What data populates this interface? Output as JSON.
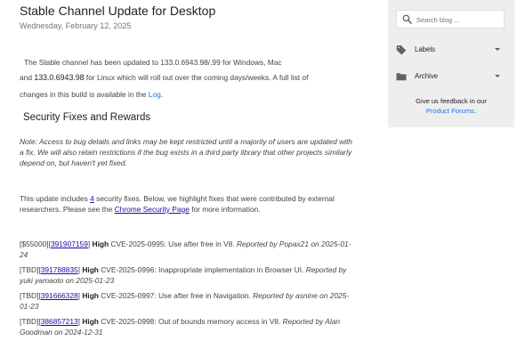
{
  "post": {
    "title": "Stable Channel Update for Desktop",
    "date": "Wednesday, February 12, 2025",
    "intro_line1": "The Stable channel has been updated to 133.0.6943.98/.99 for Windows, Mac",
    "intro_line2_prefix": "and ",
    "intro_line2_version": "133.0.6943.98",
    "intro_line2_suffix": " for Linux which will roll out over the coming days/weeks. A full list of",
    "intro_line3_prefix": "changes in this build is available in the ",
    "log_link": "Log",
    "intro_line3_suffix": ".",
    "section_heading": "Security Fixes and Rewards",
    "note": "Note: Access to bug details and links may be kept restricted until a majority of users are updated with a fix. We will also retain restrictions if the bug exists in a third party library that other projects similarly depend on, but haven't yet fixed.",
    "update_prefix": "This update includes ",
    "update_count": "4",
    "update_middle": " security fixes. Below, we highlight fixes that were contributed by external researchers. Please see the ",
    "security_page_link": "Chrome Security Page",
    "update_suffix": " for more information."
  },
  "fixes": [
    {
      "reward": "[$55000][",
      "bug": "391907159",
      "close": "]",
      "severity": "High",
      "desc": " CVE-2025-0995: Use after free in V8. ",
      "reported": "Reported by Popax21 on 2025-01-24"
    },
    {
      "reward": "[TBD][",
      "bug": "391788835",
      "close": "]",
      "severity": "High",
      "desc": " CVE-2025-0996: Inappropriate implementation in Browser UI. ",
      "reported": "Reported by yuki yamaoto on 2025-01-23"
    },
    {
      "reward": "[TBD][",
      "bug": "391666328",
      "close": "]",
      "severity": "High",
      "desc": " CVE-2025-0997: Use after free in Navigation. ",
      "reported": "Reported by asnine on 2025-01-23"
    },
    {
      "reward": "[TBD][",
      "bug": "386857213",
      "close": "]",
      "severity": "High",
      "desc": " CVE-2025-0998: Out of bounds memory access in V8. ",
      "reported": "Reported by Alan Goodman on 2024-12-31"
    }
  ],
  "sidebar": {
    "search_placeholder": "Search blog ...",
    "search_icon": "search-icon",
    "labels": "Labels",
    "labels_icon": "label-tag-icon",
    "archive": "Archive",
    "archive_icon": "folder-icon",
    "feedback_line1": "Give us feedback in our",
    "feedback_link": "Product Forums",
    "feedback_end": "."
  },
  "colors": {
    "link": "#1a73e8",
    "sidebar_bg": "#eeeeee"
  }
}
